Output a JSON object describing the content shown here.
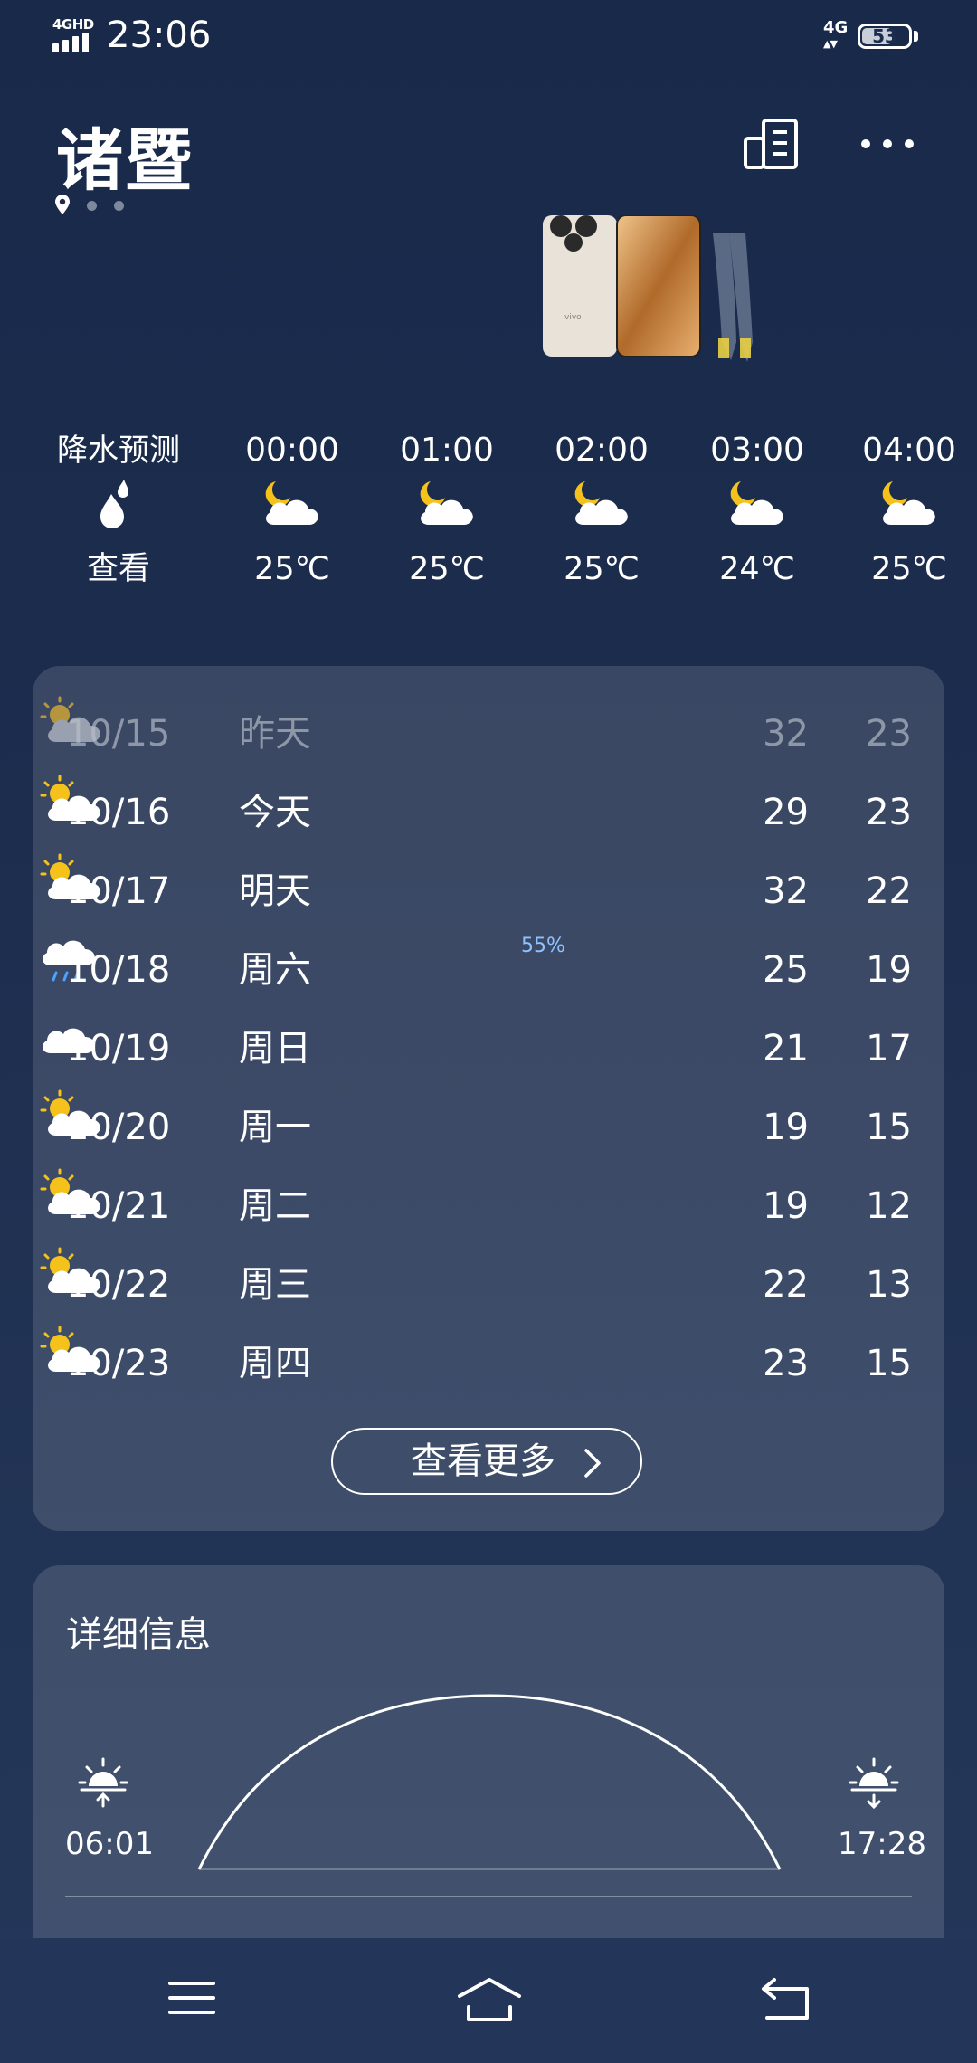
{
  "status_bar": {
    "network_label": "4GHD",
    "time": "23:06",
    "mobile_data": "4G",
    "battery": "53"
  },
  "header": {
    "city": "诸暨"
  },
  "hourly": {
    "precip_label": "降水预测",
    "precip_action": "查看",
    "hours": [
      {
        "time": "00:00",
        "temp": "25℃",
        "icon": "moon-cloud-icon"
      },
      {
        "time": "01:00",
        "temp": "25℃",
        "icon": "moon-cloud-icon"
      },
      {
        "time": "02:00",
        "temp": "25℃",
        "icon": "moon-cloud-icon"
      },
      {
        "time": "03:00",
        "temp": "24℃",
        "icon": "moon-cloud-icon"
      },
      {
        "time": "04:00",
        "temp": "25℃",
        "icon": "moon-cloud-icon"
      }
    ]
  },
  "forecast": {
    "days": [
      {
        "date": "10/15",
        "day": "昨天",
        "icon": "partly-cloudy-icon",
        "high": "32",
        "low": "23"
      },
      {
        "date": "10/16",
        "day": "今天",
        "icon": "partly-cloudy-icon",
        "high": "29",
        "low": "23"
      },
      {
        "date": "10/17",
        "day": "明天",
        "icon": "partly-cloudy-icon",
        "high": "32",
        "low": "22"
      },
      {
        "date": "10/18",
        "day": "周六",
        "icon": "rain-icon",
        "precip": "55%",
        "high": "25",
        "low": "19"
      },
      {
        "date": "10/19",
        "day": "周日",
        "icon": "cloudy-icon",
        "high": "21",
        "low": "17"
      },
      {
        "date": "10/20",
        "day": "周一",
        "icon": "partly-cloudy-icon",
        "high": "19",
        "low": "15"
      },
      {
        "date": "10/21",
        "day": "周二",
        "icon": "partly-cloudy-icon",
        "high": "19",
        "low": "12"
      },
      {
        "date": "10/22",
        "day": "周三",
        "icon": "partly-cloudy-icon",
        "high": "22",
        "low": "13"
      },
      {
        "date": "10/23",
        "day": "周四",
        "icon": "partly-cloudy-icon",
        "high": "23",
        "low": "15"
      }
    ],
    "more_label": "查看更多"
  },
  "details": {
    "title": "详细信息",
    "sunrise": "06:01",
    "sunset": "17:28"
  },
  "colors": {
    "background": "#1b2b4c",
    "sun": "#f5c21b",
    "precip_blue": "#8fc2ff"
  }
}
